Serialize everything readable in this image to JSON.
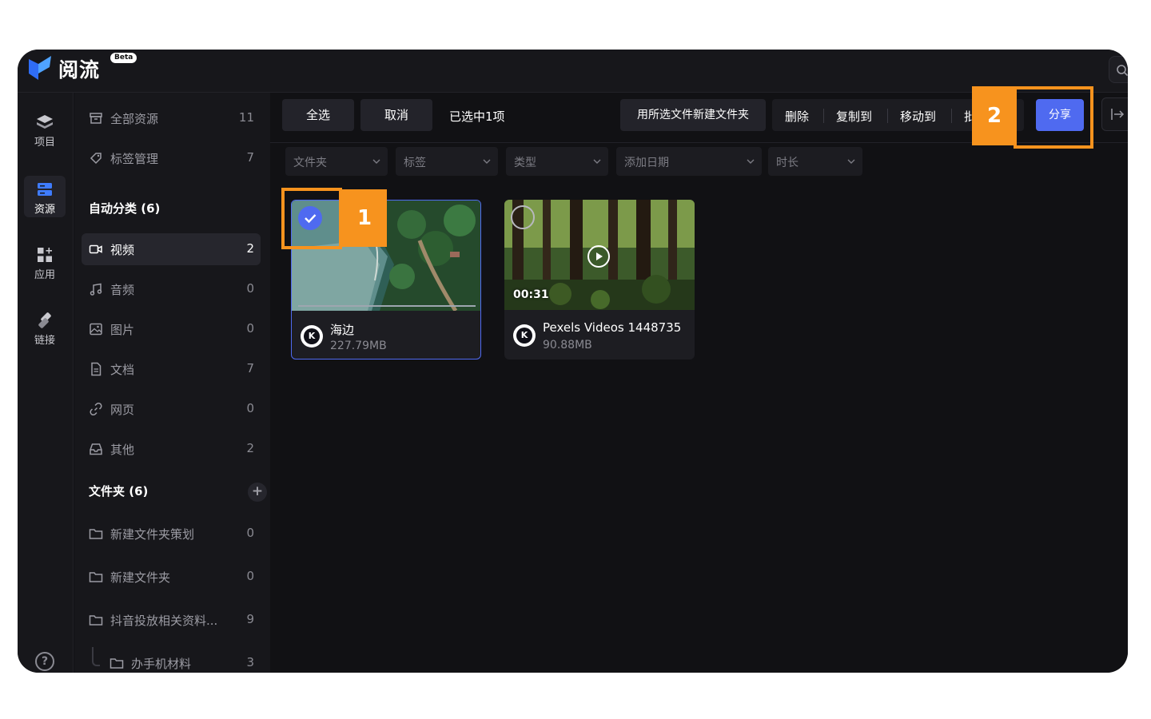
{
  "app": {
    "name": "阅流",
    "badge": "Beta"
  },
  "rail": [
    {
      "label": "项目",
      "icon": "layers-icon"
    },
    {
      "label": "资源",
      "icon": "resources-icon",
      "active": true
    },
    {
      "label": "应用",
      "icon": "apps-grid-icon"
    },
    {
      "label": "链接",
      "icon": "link-icon"
    }
  ],
  "help": {
    "glyph": "?"
  },
  "sidebar": {
    "top_items": [
      {
        "label": "全部资源",
        "count": "11",
        "icon": "archive-icon"
      },
      {
        "label": "标签管理",
        "count": "7",
        "icon": "tag-icon"
      }
    ],
    "auto_heading": "自动分类 (6)",
    "auto_items": [
      {
        "label": "视频",
        "count": "2",
        "icon": "video-icon",
        "active": true
      },
      {
        "label": "音频",
        "count": "0",
        "icon": "music-icon"
      },
      {
        "label": "图片",
        "count": "0",
        "icon": "image-icon"
      },
      {
        "label": "文档",
        "count": "7",
        "icon": "document-icon"
      },
      {
        "label": "网页",
        "count": "0",
        "icon": "link-icon"
      },
      {
        "label": "其他",
        "count": "2",
        "icon": "inbox-icon"
      }
    ],
    "folders_heading": "文件夹 (6)",
    "add_glyph": "+",
    "folders": [
      {
        "label": "新建文件夹策划",
        "count": "0"
      },
      {
        "label": "新建文件夹",
        "count": "0"
      },
      {
        "label": "抖音投放相关资料...",
        "count": "9"
      },
      {
        "label": "办手机材料",
        "count": "3"
      }
    ]
  },
  "toolbar": {
    "select_all": "全选",
    "cancel": "取消",
    "selected_text": "已选中1项",
    "new_folder": "用所选文件新建文件夹",
    "delete": "删除",
    "copy_to": "复制到",
    "move_to": "移动到",
    "more": "批",
    "share": "分享"
  },
  "filters": [
    {
      "label": "文件夹"
    },
    {
      "label": "标签"
    },
    {
      "label": "类型"
    },
    {
      "label": "添加日期"
    },
    {
      "label": "时长"
    }
  ],
  "cards": [
    {
      "name": "海边",
      "size": "227.79MB",
      "selected": true,
      "duration": "",
      "avatar": "K"
    },
    {
      "name": "Pexels Videos 1448735",
      "size": "90.88MB",
      "selected": false,
      "duration": "00:31",
      "avatar": "K"
    }
  ],
  "callouts": [
    {
      "number": "1"
    },
    {
      "number": "2"
    }
  ],
  "colors": {
    "accent": "#4f6af0",
    "callout": "#f7931e",
    "background": "#111114",
    "panel": "#17171b"
  }
}
